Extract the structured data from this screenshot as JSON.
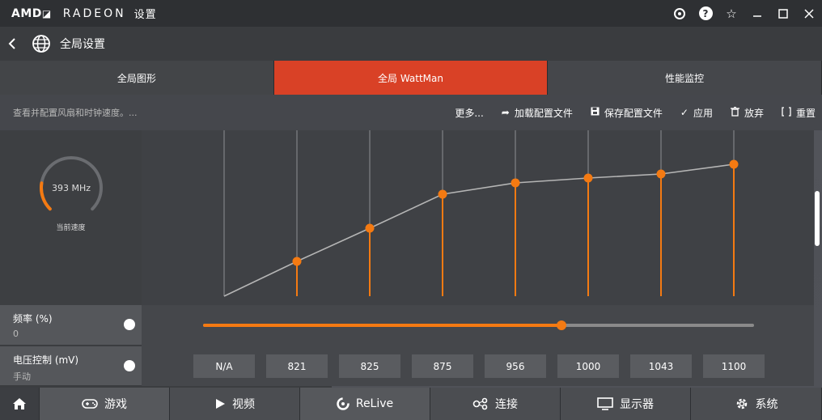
{
  "titlebar": {
    "brand_amd": "AMD",
    "brand_radeon": "RADEON",
    "brand_settings": "设置",
    "icons": [
      "refresh-icon",
      "help-icon",
      "star-icon",
      "minimize-icon",
      "maximize-icon",
      "close-icon"
    ]
  },
  "header": {
    "title": "全局设置"
  },
  "tabs": [
    {
      "label": "全局图形",
      "active": false
    },
    {
      "label": "全局 WattMan",
      "active": true
    },
    {
      "label": "性能监控",
      "active": false
    }
  ],
  "toolbar": {
    "description": "查看并配置风扇和时钟速度。...",
    "more_label": "更多...",
    "load_label": "加载配置文件",
    "save_label": "保存配置文件",
    "apply_label": "应用",
    "discard_label": "放弃",
    "reset_label": "重置"
  },
  "gauge": {
    "value": "393 MHz",
    "label": "当前速度",
    "fraction": 0.2
  },
  "controls": {
    "frequency": {
      "label": "频率 (%)",
      "value": "0"
    },
    "voltage": {
      "label": "电压控制 (mV)",
      "value": "手动"
    }
  },
  "chart_data": {
    "type": "line",
    "points": [
      {
        "state": 0,
        "voltage": "N/A",
        "height": 0.0
      },
      {
        "state": 1,
        "voltage": "821",
        "height": 0.215
      },
      {
        "state": 2,
        "voltage": "825",
        "height": 0.42
      },
      {
        "state": 3,
        "voltage": "875",
        "height": 0.63
      },
      {
        "state": 4,
        "voltage": "956",
        "height": 0.7
      },
      {
        "state": 5,
        "voltage": "1000",
        "height": 0.73
      },
      {
        "state": 6,
        "voltage": "1043",
        "height": 0.755
      },
      {
        "state": 7,
        "voltage": "1100",
        "height": 0.815
      }
    ],
    "accent": "#f47a12"
  },
  "slider": {
    "fraction": 0.65
  },
  "voltage_values": [
    "N/A",
    "821",
    "825",
    "875",
    "956",
    "1000",
    "1043",
    "1100"
  ],
  "nav": {
    "home_icon": "home-icon",
    "items": [
      {
        "label": "游戏",
        "icon": "gamepad-icon"
      },
      {
        "label": "视频",
        "icon": "play-icon"
      },
      {
        "label": "ReLive",
        "icon": "relive-icon"
      },
      {
        "label": "连接",
        "icon": "connect-icon"
      },
      {
        "label": "显示器",
        "icon": "monitor-icon"
      },
      {
        "label": "系统",
        "icon": "gear-icon"
      }
    ]
  }
}
